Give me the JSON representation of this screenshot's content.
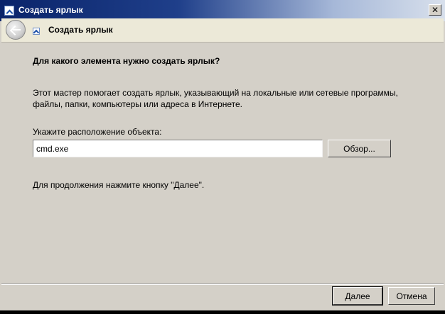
{
  "window": {
    "title": "Создать ярлык",
    "close_glyph": "✕"
  },
  "header": {
    "title": "Создать ярлык",
    "back_icon": "back-arrow-icon"
  },
  "content": {
    "question": "Для какого элемента нужно создать ярлык?",
    "description": "Этот мастер помогает создать ярлык, указывающий на локальные или сетевые программы, файлы, папки, компьютеры или адреса в Интернете.",
    "location_label": "Укажите расположение объекта:",
    "location_value": "cmd.exe",
    "browse_label": "Обзор...",
    "continue_hint": "Для продолжения нажмите кнопку \"Далее\"."
  },
  "footer": {
    "next_label": "Далее",
    "cancel_label": "Отмена"
  },
  "colors": {
    "title_bar": "#0a246a",
    "face": "#d4d0c8"
  }
}
